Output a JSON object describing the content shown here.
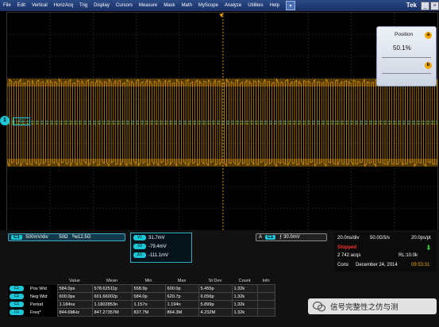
{
  "menu": {
    "items": [
      "File",
      "Edit",
      "Vertical",
      "HorizAcq",
      "Trig",
      "Display",
      "Cursors",
      "Measure",
      "Mask",
      "Math",
      "MyScope",
      "Analyze",
      "Utilities",
      "Help"
    ],
    "brand": "Tek"
  },
  "display": {
    "ch1_marker": "1",
    "ch1_tag": "C1"
  },
  "position_panel": {
    "title": "Position",
    "value": "50.1%",
    "knob_a": "a",
    "knob_b": "b"
  },
  "channel": {
    "label": "C1",
    "scale": "500mV/div",
    "impedance": "50Ω",
    "bandwidth": "ᴮw12.5G"
  },
  "cursors": [
    {
      "tag": "V1",
      "value": "31.7mV"
    },
    {
      "tag": "V2",
      "value": "-79.4mV"
    },
    {
      "tag": "ΔV",
      "value": "-111.1mV"
    }
  ],
  "trigger": {
    "label": "C1",
    "slope": "ƒ",
    "level": "30.0mV"
  },
  "acquisition": {
    "timebase": "20.0ns/div",
    "sample_rate": "50.0GS/s",
    "resolution": "20.0ps/pt",
    "state": "Stopped",
    "acqs": "2 742 acqs",
    "record_length": "RL:10.0k",
    "mode": "Cons",
    "date": "December 24, 2014",
    "time": "09:53:31"
  },
  "measurements": {
    "headers": [
      "",
      "",
      "Value",
      "Mean",
      "Min",
      "Max",
      "St Dev",
      "Count",
      "Info"
    ],
    "rows": [
      {
        "ch": "C1",
        "name": "Pos Wid",
        "value": "584.0ps",
        "mean": "578.62511p",
        "min": "558.9p",
        "max": "600.0p",
        "stdev": "5.455p",
        "count": "1.32k"
      },
      {
        "ch": "C1",
        "name": "Neg Wid",
        "value": "600.0ps",
        "mean": "601.66002p",
        "min": "584.0p",
        "max": "620.7p",
        "stdev": "6.056p",
        "count": "1.32k"
      },
      {
        "ch": "C1",
        "name": "Period",
        "value": "1.184ns",
        "mean": "1.1802853n",
        "min": "1.157n",
        "max": "1.194n",
        "stdev": "5.899p",
        "count": "1.32k"
      },
      {
        "ch": "C1",
        "name": "Freq*",
        "value": "844.6MHz",
        "mean": "847.27357M",
        "min": "837.7M",
        "max": "864.3M",
        "stdev": "4.232M",
        "count": "1.32k"
      }
    ]
  },
  "watermark": {
    "text": "信号完整性之仿与测"
  },
  "colors": {
    "trace": "#f2a500",
    "ch1": "#1cc6d6",
    "stopped": "#ff3030",
    "menubar": "#1f3a74"
  }
}
